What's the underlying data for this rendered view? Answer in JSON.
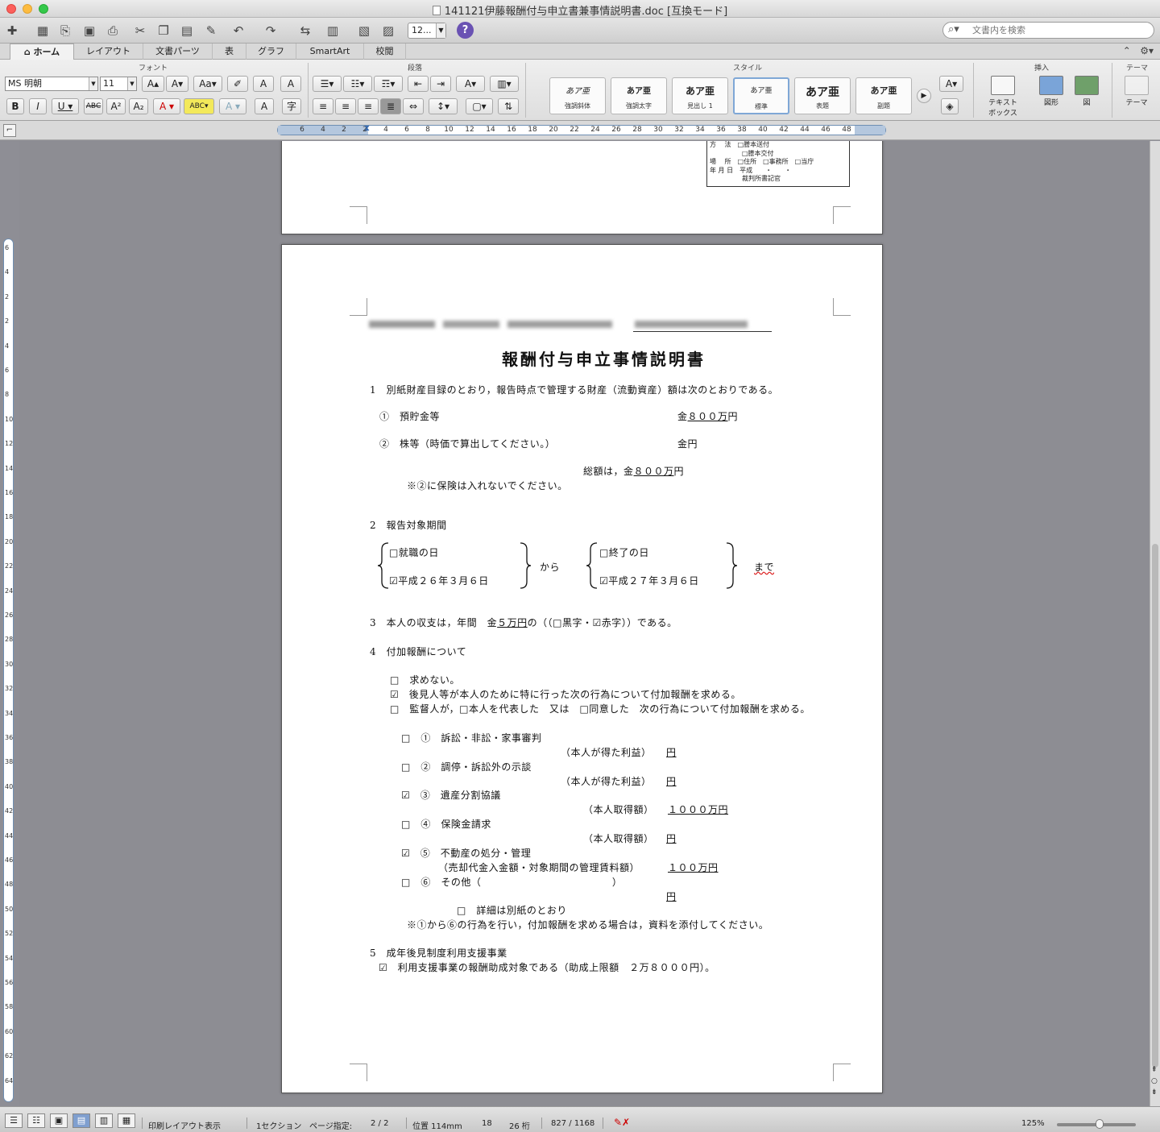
{
  "window": {
    "title": "141121伊藤報酬付与申立書兼事情説明書.doc [互換モード]"
  },
  "toolbar": {
    "zoom": "12...",
    "search_placeholder": "文書内を検索",
    "help": "?"
  },
  "ribbon_tabs": [
    "ホーム",
    "レイアウト",
    "文書パーツ",
    "表",
    "グラフ",
    "SmartArt",
    "校閲"
  ],
  "ribbon": {
    "groups": {
      "font": "フォント",
      "paragraph": "段落",
      "style": "スタイル",
      "insert": "挿入",
      "theme": "テーマ"
    },
    "font_name": "MS 明朝",
    "font_size": "11",
    "styles": [
      {
        "sample": "あア亜",
        "name": "強調斜体"
      },
      {
        "sample": "あア亜",
        "name": "強調太字"
      },
      {
        "sample": "あア亜",
        "name": "見出し 1"
      },
      {
        "sample": "あア亜",
        "name": "標準"
      },
      {
        "sample": "あア亜",
        "name": "表題"
      },
      {
        "sample": "あア亜",
        "name": "副題"
      }
    ],
    "insert": {
      "textbox_line1": "テキスト",
      "textbox_line2": "ボックス",
      "shapes": "図形",
      "picture": "図"
    },
    "theme": "テーマ"
  },
  "ruler": {
    "numbers": [
      "6",
      "4",
      "2",
      "2",
      "4",
      "6",
      "8",
      "10",
      "12",
      "14",
      "16",
      "18",
      "20",
      "22",
      "24",
      "26",
      "28",
      "30",
      "32",
      "34",
      "36",
      "38",
      "40",
      "42",
      "44",
      "46",
      "48"
    ],
    "v_numbers": [
      "6",
      "4",
      "2",
      "2",
      "4",
      "6",
      "8",
      "10",
      "12",
      "14",
      "16",
      "18",
      "20",
      "22",
      "24",
      "26",
      "28",
      "30",
      "32",
      "34",
      "36",
      "38",
      "40",
      "42",
      "44",
      "46",
      "48",
      "50",
      "52",
      "54",
      "56",
      "58",
      "60",
      "62",
      "64"
    ]
  },
  "prev_page_box": {
    "lines": [
      "方　 法　□謄本送付",
      "　　　　　□謄本交付",
      "場　 所　□住所　□事務所　□当庁",
      "年 月 日　平成　　・　　・",
      "　　　　　裁判所書記官"
    ]
  },
  "document": {
    "title": "報酬付与申立事情説明書",
    "s1_heading": "1　別紙財産目録のとおり，報告時点で管理する財産（流動資産）額は次のとおりである。",
    "s1_item1_label": "①　預貯金等",
    "s1_item1_prefix": "金",
    "s1_item1_value": "８００万",
    "s1_item1_suffix": "円",
    "s1_item2_label": "②　株等（時価で算出してください。）",
    "s1_item2_value": "金円",
    "s1_total_prefix": "総額は，金",
    "s1_total_value": "８００万",
    "s1_total_suffix": "円",
    "s1_note": "※②に保険は入れないでください。",
    "s2_heading": "2　報告対象期間",
    "s2_start_opt1": "□就職の日",
    "s2_start_opt2": "☑平成２６年３月６日",
    "s2_from": "から",
    "s2_end_opt1": "□終了の日",
    "s2_end_opt2": "☑平成２７年３月６日",
    "s2_until": "まで",
    "s3_prefix": "3　本人の収支は，年間　金",
    "s3_value": "５万円",
    "s3_suffix": "の（（□黒字・☑赤字））である。",
    "s4_heading": "4　付加報酬について",
    "s4_opt1": "□　求めない。",
    "s4_opt2": "☑　後見人等が本人のために特に行った次の行為について付加報酬を求める。",
    "s4_opt3": "□　監督人が，□本人を代表した　又は　□同意した　次の行為について付加報酬を求める。",
    "acts": [
      {
        "label": "□　①　訴訟・非訟・家事審判",
        "sub": "（本人が得た利益）",
        "amount": "円"
      },
      {
        "label": "□　②　調停・訴訟外の示談",
        "sub": "（本人が得た利益）",
        "amount": "円"
      },
      {
        "label": "☑　③　遺産分割協議",
        "sub": "（本人取得額）",
        "amount": "１０００万円"
      },
      {
        "label": "□　④　保険金請求",
        "sub": "（本人取得額）",
        "amount": "円"
      },
      {
        "label": "☑　⑤　不動産の処分・管理",
        "sub": "（売却代金入金額・対象期間の管理賃料額）",
        "amount": "１００万円"
      },
      {
        "label": "□　⑥　その他（　　　　　　　　　　　　　）",
        "sub": "",
        "amount": "円"
      }
    ],
    "s4_detail": "□　詳細は別紙のとおり",
    "s4_note": "※①から⑥の行為を行い，付加報酬を求める場合は，資料を添付してください。",
    "s5_heading": "5　成年後見制度利用支援事業",
    "s5_item": "☑　利用支援事業の報酬助成対象である（助成上限額　２万８０００円）。"
  },
  "statusbar": {
    "view": "印刷レイアウト表示",
    "section": "1セクション",
    "page_label": "ページ指定:",
    "page": "2 / 2",
    "position": "位置 114mm",
    "line": "18",
    "column": "26 桁",
    "words": "827 / 1168",
    "zoom": "125%"
  }
}
